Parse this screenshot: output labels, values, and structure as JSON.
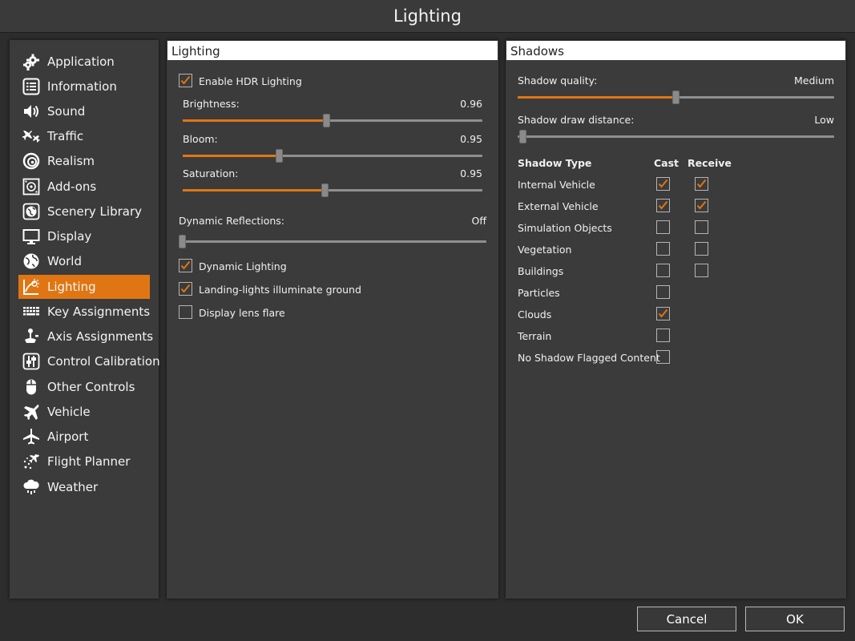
{
  "window": {
    "title": "Lighting"
  },
  "sidebar": {
    "items": [
      {
        "label": "Application",
        "icon": "gear-icon"
      },
      {
        "label": "Information",
        "icon": "list-icon"
      },
      {
        "label": "Sound",
        "icon": "speaker-icon"
      },
      {
        "label": "Traffic",
        "icon": "traffic-planes-icon"
      },
      {
        "label": "Realism",
        "icon": "realism-icon"
      },
      {
        "label": "Add-ons",
        "icon": "addons-icon"
      },
      {
        "label": "Scenery Library",
        "icon": "scenery-icon"
      },
      {
        "label": "Display",
        "icon": "monitor-icon"
      },
      {
        "label": "World",
        "icon": "globe-icon"
      },
      {
        "label": "Lighting",
        "icon": "lighting-icon",
        "active": true
      },
      {
        "label": "Key Assignments",
        "icon": "keyboard-icon"
      },
      {
        "label": "Axis Assignments",
        "icon": "joystick-icon"
      },
      {
        "label": "Control Calibration",
        "icon": "calibration-icon"
      },
      {
        "label": "Other Controls",
        "icon": "mouse-icon"
      },
      {
        "label": "Vehicle",
        "icon": "airplane-icon"
      },
      {
        "label": "Airport",
        "icon": "airport-plane-icon"
      },
      {
        "label": "Flight Planner",
        "icon": "flight-planner-icon"
      },
      {
        "label": "Weather",
        "icon": "weather-icon"
      }
    ]
  },
  "lighting": {
    "header": "Lighting",
    "enable_hdr": {
      "label": "Enable HDR Lighting",
      "checked": true
    },
    "brightness": {
      "label": "Brightness:",
      "value": "0.96",
      "fraction": 0.48
    },
    "bloom": {
      "label": "Bloom:",
      "value": "0.95",
      "fraction": 0.32
    },
    "saturation": {
      "label": "Saturation:",
      "value": "0.95",
      "fraction": 0.475
    },
    "reflections": {
      "label": "Dynamic Reflections:",
      "value": "Off",
      "fraction": 0.0
    },
    "dynamic_lighting": {
      "label": "Dynamic Lighting",
      "checked": true
    },
    "landing_lights": {
      "label": "Landing-lights illuminate ground",
      "checked": true
    },
    "lens_flare": {
      "label": "Display lens flare",
      "checked": false
    }
  },
  "shadows": {
    "header": "Shadows",
    "quality": {
      "label": "Shadow quality:",
      "value": "Medium",
      "fraction": 0.5
    },
    "draw_distance": {
      "label": "Shadow draw distance:",
      "value": "Low",
      "fraction": 0.0
    },
    "table": {
      "col_type": "Shadow Type",
      "col_cast": "Cast",
      "col_receive": "Receive",
      "rows": [
        {
          "label": "Internal Vehicle",
          "cast": true,
          "receive": true
        },
        {
          "label": "External Vehicle",
          "cast": true,
          "receive": true
        },
        {
          "label": "Simulation Objects",
          "cast": false,
          "receive": false
        },
        {
          "label": "Vegetation",
          "cast": false,
          "receive": false
        },
        {
          "label": "Buildings",
          "cast": false,
          "receive": false
        },
        {
          "label": "Particles",
          "cast": false
        },
        {
          "label": "Clouds",
          "cast": true
        },
        {
          "label": "Terrain",
          "cast": false
        },
        {
          "label": "No Shadow Flagged Content",
          "cast": false
        }
      ]
    }
  },
  "buttons": {
    "cancel": "Cancel",
    "ok": "OK"
  },
  "colors": {
    "accent": "#e07613",
    "panel": "#3b3b3b",
    "background": "#2d2d2d"
  }
}
